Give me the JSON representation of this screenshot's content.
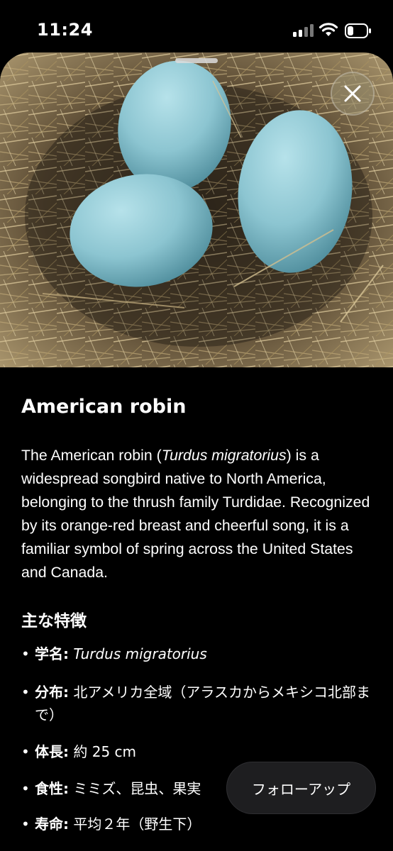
{
  "status_bar": {
    "time": "11:24",
    "signal_icon": "cellular-signal-icon",
    "wifi_icon": "wifi-icon",
    "battery_icon": "battery-low-icon",
    "battery_level": 0.3
  },
  "image": {
    "subject": "nest-with-three-blue-eggs",
    "close_icon": "close-icon"
  },
  "article": {
    "title": "American robin",
    "description_parts": {
      "before": "The American robin (",
      "scientific": "Turdus migratorius",
      "after": ") is a widespread songbird native to North America, belonging to the thrush family Turdidae. Recognized by its orange-red breast and cheerful song, it is a familiar symbol of spring across the United States and Canada."
    },
    "section_title": "主な特徴",
    "facts": [
      {
        "label": "学名:",
        "value": "Turdus migratorius"
      },
      {
        "label": "分布:",
        "value": "北アメリカ全域（アラスカからメキシコ北部まで）"
      },
      {
        "label": "体長:",
        "value": "約 25 cm"
      },
      {
        "label": "食性:",
        "value": "ミミズ、昆虫、果実"
      },
      {
        "label": "寿命:",
        "value": "平均２年（野生下）"
      }
    ],
    "bullet": "•"
  },
  "followup_button": {
    "label": "フォローアップ"
  },
  "colors": {
    "background": "#000000",
    "egg": "#8ec8d4",
    "straw": "#c9b48a"
  }
}
